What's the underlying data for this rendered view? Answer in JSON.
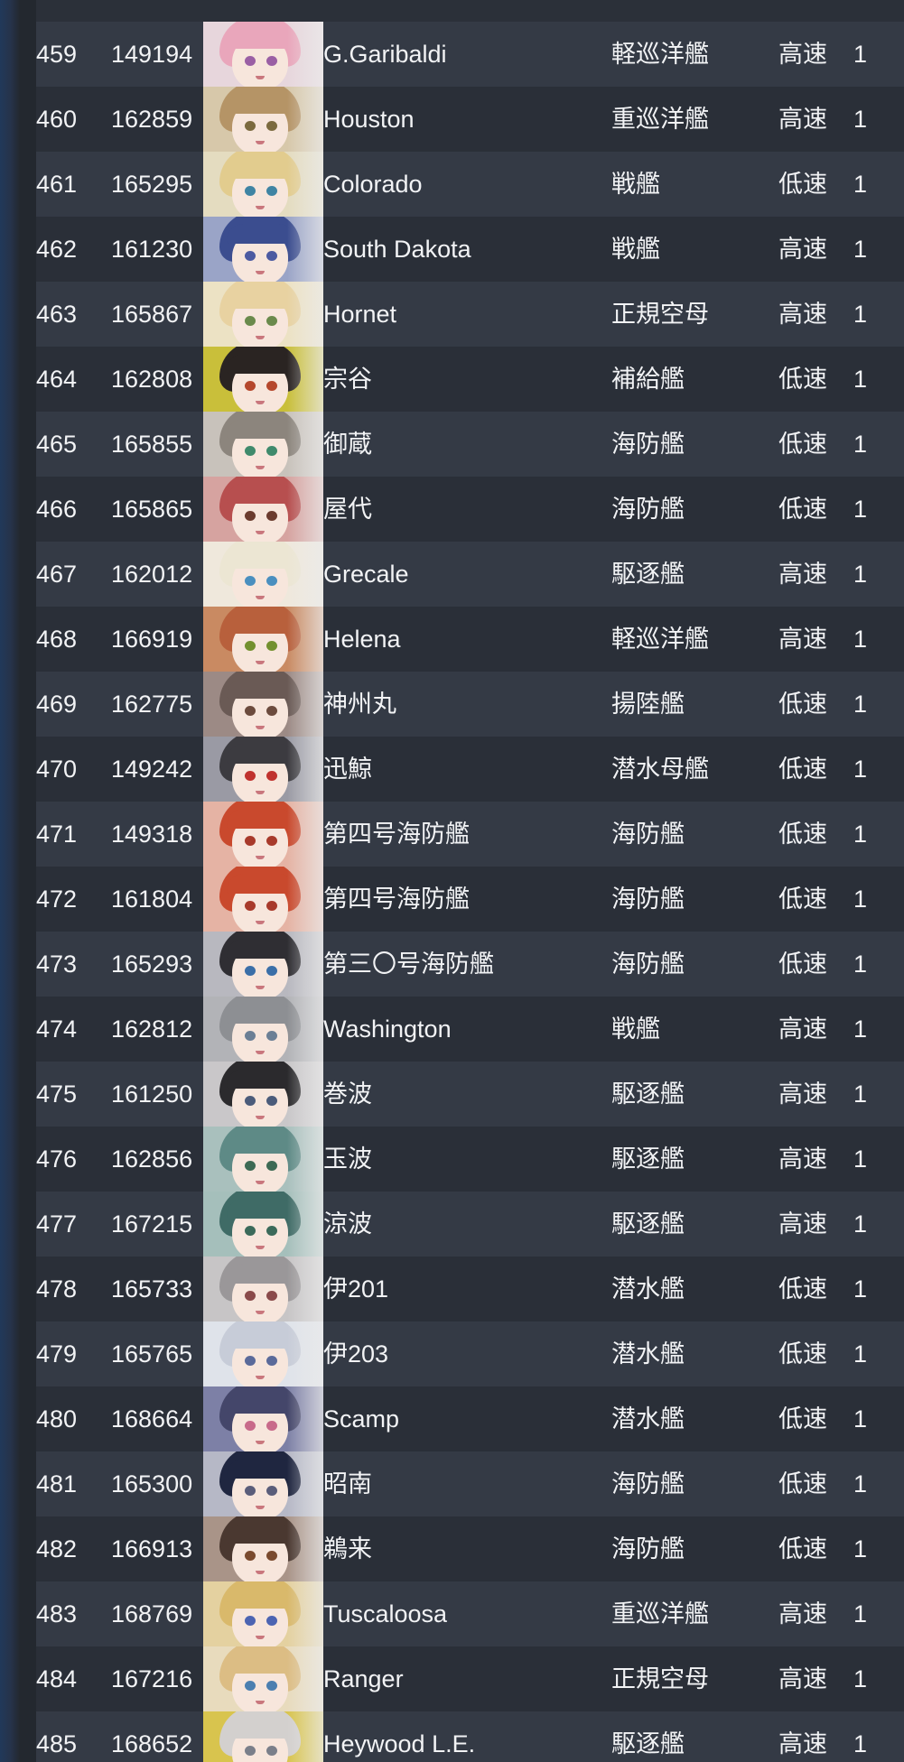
{
  "ships": [
    {
      "no": "459",
      "id": "149194",
      "name": "G.Garibaldi",
      "type": "軽巡洋艦",
      "speed": "高速",
      "level": "1",
      "hair": "#e9a6bb",
      "eye": "#9a5fa4",
      "bg": "#e7d6dc"
    },
    {
      "no": "460",
      "id": "162859",
      "name": "Houston",
      "type": "重巡洋艦",
      "speed": "高速",
      "level": "1",
      "hair": "#b59466",
      "eye": "#7b6a3e",
      "bg": "#d7c8aa"
    },
    {
      "no": "461",
      "id": "165295",
      "name": "Colorado",
      "type": "戦艦",
      "speed": "低速",
      "level": "1",
      "hair": "#e2cc8e",
      "eye": "#3f84a3",
      "bg": "#e4dcc0"
    },
    {
      "no": "462",
      "id": "161230",
      "name": "South Dakota",
      "type": "戦艦",
      "speed": "高速",
      "level": "1",
      "hair": "#3b4d8f",
      "eye": "#4c5aa1",
      "bg": "#9aa4c7"
    },
    {
      "no": "463",
      "id": "165867",
      "name": "Hornet",
      "type": "正規空母",
      "speed": "高速",
      "level": "1",
      "hair": "#e8d2a1",
      "eye": "#6a8a4c",
      "bg": "#ece2c4"
    },
    {
      "no": "464",
      "id": "162808",
      "name": "宗谷",
      "type": "補給艦",
      "speed": "低速",
      "level": "1",
      "hair": "#2a2422",
      "eye": "#b5472c",
      "bg": "#c9bf3a"
    },
    {
      "no": "465",
      "id": "165855",
      "name": "御蔵",
      "type": "海防艦",
      "speed": "低速",
      "level": "1",
      "hair": "#8c857d",
      "eye": "#3f8a6c",
      "bg": "#c8c2bb"
    },
    {
      "no": "466",
      "id": "165865",
      "name": "屋代",
      "type": "海防艦",
      "speed": "低速",
      "level": "1",
      "hair": "#b74f4f",
      "eye": "#6b3b2e",
      "bg": "#d6a3a0"
    },
    {
      "no": "467",
      "id": "162012",
      "name": "Grecale",
      "type": "駆逐艦",
      "speed": "高速",
      "level": "1",
      "hair": "#ece6d3",
      "eye": "#4a8fbf",
      "bg": "#efe8dc"
    },
    {
      "no": "468",
      "id": "166919",
      "name": "Helena",
      "type": "軽巡洋艦",
      "speed": "高速",
      "level": "1",
      "hair": "#b8603c",
      "eye": "#73902e",
      "bg": "#c98a62"
    },
    {
      "no": "469",
      "id": "162775",
      "name": "神州丸",
      "type": "揚陸艦",
      "speed": "低速",
      "level": "1",
      "hair": "#6a5a55",
      "eye": "#6c4b3d",
      "bg": "#9c8a85"
    },
    {
      "no": "470",
      "id": "149242",
      "name": "迅鯨",
      "type": "潜水母艦",
      "speed": "低速",
      "level": "1",
      "hair": "#3c3b40",
      "eye": "#c0322e",
      "bg": "#9a9aa4"
    },
    {
      "no": "471",
      "id": "149318",
      "name": "第四号海防艦",
      "type": "海防艦",
      "speed": "低速",
      "level": "1",
      "hair": "#c9492d",
      "eye": "#a83a2b",
      "bg": "#e5b3a4"
    },
    {
      "no": "472",
      "id": "161804",
      "name": "第四号海防艦",
      "type": "海防艦",
      "speed": "低速",
      "level": "1",
      "hair": "#c9492d",
      "eye": "#a83a2b",
      "bg": "#e5b3a4"
    },
    {
      "no": "473",
      "id": "165293",
      "name": "第三〇号海防艦",
      "type": "海防艦",
      "speed": "低速",
      "level": "1",
      "hair": "#2f2e33",
      "eye": "#3b6fa8",
      "bg": "#b8b8bf"
    },
    {
      "no": "474",
      "id": "162812",
      "name": "Washington",
      "type": "戦艦",
      "speed": "高速",
      "level": "1",
      "hair": "#8d8f93",
      "eye": "#6b7f95",
      "bg": "#b2b3b7"
    },
    {
      "no": "475",
      "id": "161250",
      "name": "巻波",
      "type": "駆逐艦",
      "speed": "高速",
      "level": "1",
      "hair": "#2b2a2d",
      "eye": "#4b5b7a",
      "bg": "#c9c7c9"
    },
    {
      "no": "476",
      "id": "162856",
      "name": "玉波",
      "type": "駆逐艦",
      "speed": "高速",
      "level": "1",
      "hair": "#5e8a86",
      "eye": "#3d6a54",
      "bg": "#a9c0bd"
    },
    {
      "no": "477",
      "id": "167215",
      "name": "涼波",
      "type": "駆逐艦",
      "speed": "高速",
      "level": "1",
      "hair": "#3f6b66",
      "eye": "#3b6a5a",
      "bg": "#a5bfbb"
    },
    {
      "no": "478",
      "id": "165733",
      "name": "伊201",
      "type": "潜水艦",
      "speed": "低速",
      "level": "1",
      "hair": "#9a9799",
      "eye": "#8a4a4a",
      "bg": "#c7c5c6"
    },
    {
      "no": "479",
      "id": "165765",
      "name": "伊203",
      "type": "潜水艦",
      "speed": "低速",
      "level": "1",
      "hair": "#c7ccd8",
      "eye": "#5a6a9a",
      "bg": "#dfe3ea"
    },
    {
      "no": "480",
      "id": "168664",
      "name": "Scamp",
      "type": "潜水艦",
      "speed": "低速",
      "level": "1",
      "hair": "#44466a",
      "eye": "#c86a8a",
      "bg": "#7d80a6"
    },
    {
      "no": "481",
      "id": "165300",
      "name": "昭南",
      "type": "海防艦",
      "speed": "低速",
      "level": "1",
      "hair": "#1f2640",
      "eye": "#5a5d7a",
      "bg": "#b6b8c6"
    },
    {
      "no": "482",
      "id": "166913",
      "name": "鵜来",
      "type": "海防艦",
      "speed": "低速",
      "level": "1",
      "hair": "#4a3830",
      "eye": "#7a4a2e",
      "bg": "#a99488"
    },
    {
      "no": "483",
      "id": "168769",
      "name": "Tuscaloosa",
      "type": "重巡洋艦",
      "speed": "高速",
      "level": "1",
      "hair": "#d9b96b",
      "eye": "#4c64b2",
      "bg": "#e4d1a0"
    },
    {
      "no": "484",
      "id": "167216",
      "name": "Ranger",
      "type": "正規空母",
      "speed": "高速",
      "level": "1",
      "hair": "#dcbd84",
      "eye": "#4b7fb0",
      "bg": "#e8dbbd"
    },
    {
      "no": "485",
      "id": "168652",
      "name": "Heywood L.E.",
      "type": "駆逐艦",
      "speed": "高速",
      "level": "1",
      "hair": "#d3d0ce",
      "eye": "#7a7f8a",
      "bg": "#d8c44e"
    }
  ]
}
